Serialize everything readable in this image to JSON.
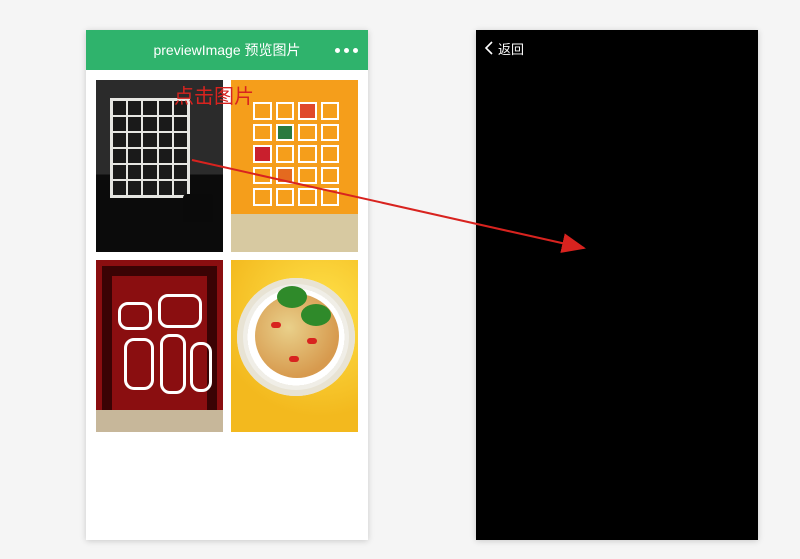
{
  "annotation": {
    "click_label": "点击图片"
  },
  "left_phone": {
    "header": {
      "title": "previewImage 预览图片"
    },
    "thumbnails": [
      {
        "name": "white-shelf-dark-room"
      },
      {
        "name": "orange-wall-shelf"
      },
      {
        "name": "red-wall-rounded-shelves"
      },
      {
        "name": "pasta-dish-yellow-bg"
      }
    ]
  },
  "right_phone": {
    "header": {
      "back_label": "返回"
    }
  },
  "colors": {
    "header_green": "#2fb36c",
    "annotation_red": "#d8231f"
  }
}
